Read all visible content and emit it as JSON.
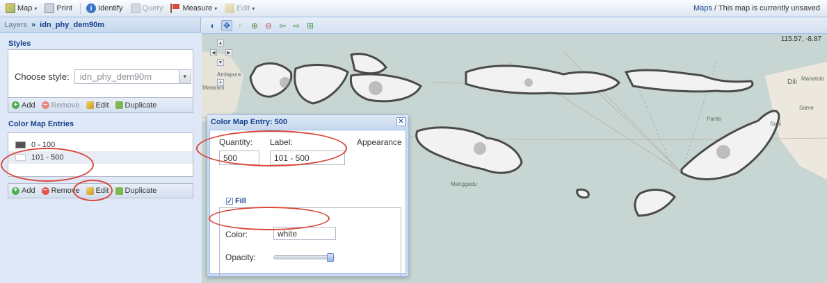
{
  "toolbar": {
    "map": "Map",
    "print": "Print",
    "identify": "Identify",
    "query": "Query",
    "measure": "Measure",
    "edit": "Edit"
  },
  "status": {
    "maps_link": "Maps",
    "message": " / This map is currently unsaved"
  },
  "breadcrumb": {
    "root": "Layers",
    "separator": "»",
    "current": "idn_phy_dem90m"
  },
  "styles": {
    "title": "Styles",
    "choose_label": "Choose style:",
    "selected": "idn_phy_dem90m",
    "actions": {
      "add": "Add",
      "remove": "Remove",
      "edit": "Edit",
      "duplicate": "Duplicate"
    }
  },
  "color_map": {
    "title": "Color Map Entries",
    "entries": [
      {
        "label": "0 - 100",
        "color": "#555555"
      },
      {
        "label": "101 - 500",
        "color": "#ffffff"
      }
    ],
    "actions": {
      "add": "Add",
      "remove": "Remove",
      "edit": "Edit",
      "duplicate": "Duplicate"
    }
  },
  "map": {
    "coordinates": "115.57, -8.87",
    "labels": {
      "amlapura": "Amlapura",
      "mataram": "Mataram",
      "manggudu": "Manggudu",
      "dili": "Dili",
      "manatuto": "Manatuto",
      "same": "Same",
      "suai": "Suai",
      "pante": "Pante"
    }
  },
  "dialog": {
    "title": "Color Map Entry: 500",
    "quantity_label": "Quantity:",
    "quantity_value": "500",
    "label_label": "Label:",
    "label_value": "101 - 500",
    "appearance_label": "Appearance",
    "fill_label": "Fill",
    "color_label": "Color:",
    "color_value": "white",
    "opacity_label": "Opacity:",
    "opacity": 1.0
  }
}
